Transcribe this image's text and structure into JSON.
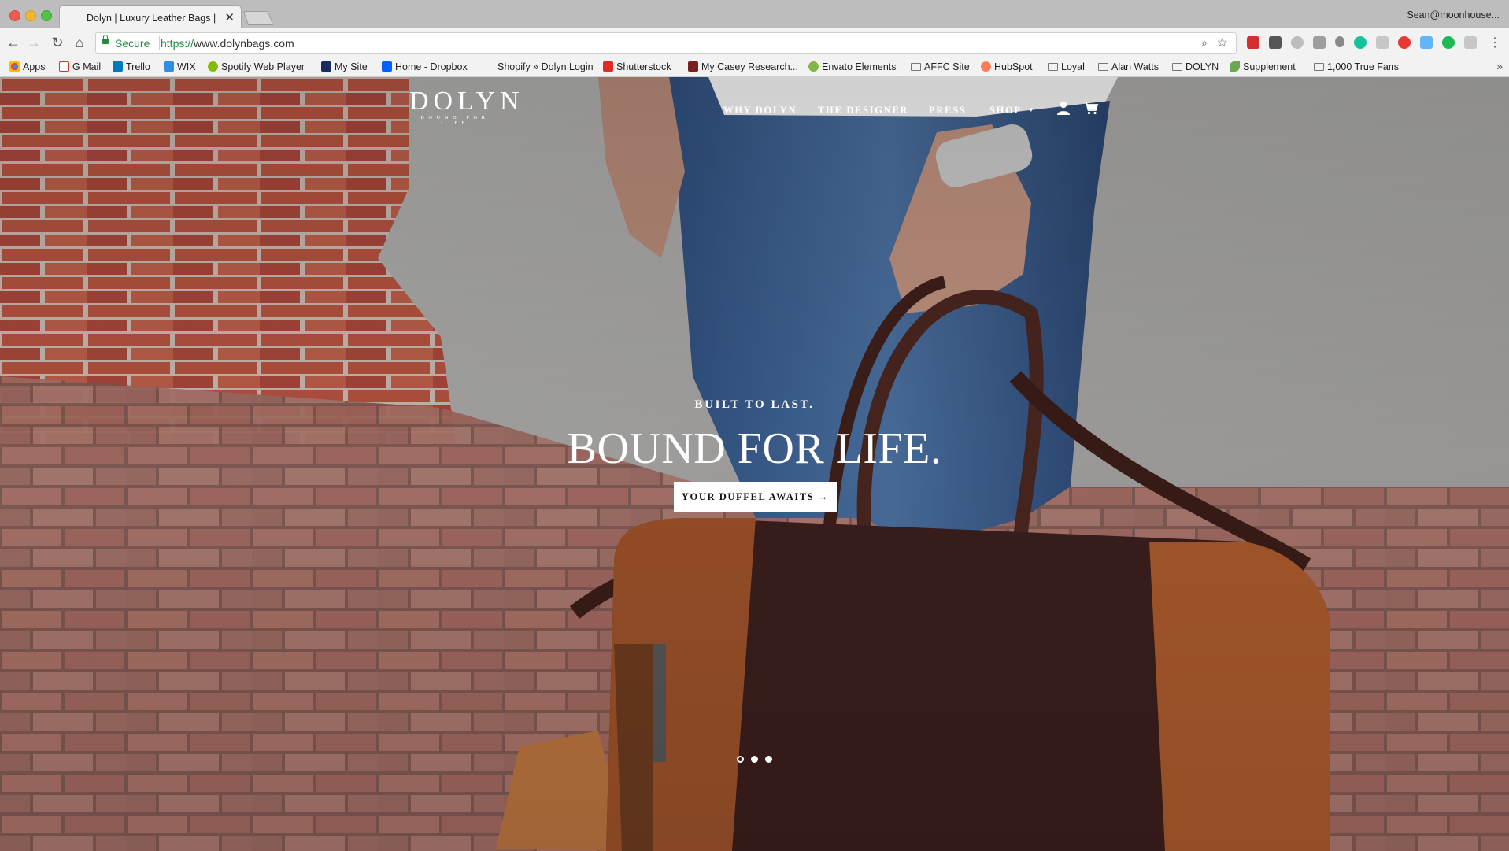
{
  "browser": {
    "tab_title": "Dolyn | Luxury Leather Bags |",
    "profile": "Sean@moonhouse...",
    "secure_label": "Secure",
    "url_scheme": "https://",
    "url_host": "www.dolynbags.com"
  },
  "bookmarks": [
    {
      "label": "Apps",
      "icon": "apps-grid-icon",
      "color": "#4285f4"
    },
    {
      "label": "G Mail",
      "icon": "gmail-icon",
      "color": "#d93025"
    },
    {
      "label": "Trello",
      "icon": "trello-icon",
      "color": "#0079bf"
    },
    {
      "label": "WIX",
      "icon": "wix-icon",
      "color": "#2f8de4"
    },
    {
      "label": "Spotify Web Player",
      "icon": "spotify-icon",
      "color": "#84bd00"
    },
    {
      "label": "My Site",
      "icon": "site-icon",
      "color": "#1a2b5e"
    },
    {
      "label": "Home - Dropbox",
      "icon": "dropbox-icon",
      "color": "#0061fe"
    },
    {
      "label": "Shopify » Dolyn Login",
      "icon": "",
      "color": ""
    },
    {
      "label": "Shutterstock",
      "icon": "shutterstock-icon",
      "color": "#e22a24"
    },
    {
      "label": "My Casey Research...",
      "icon": "casey-icon",
      "color": "#7a1f1f"
    },
    {
      "label": "Envato Elements",
      "icon": "envato-icon",
      "color": "#82b541"
    },
    {
      "label": "AFFC Site",
      "icon": "folder-icon",
      "color": ""
    },
    {
      "label": "HubSpot",
      "icon": "hubspot-icon",
      "color": "#ff7a59"
    },
    {
      "label": "Loyal",
      "icon": "folder-icon",
      "color": ""
    },
    {
      "label": "Alan Watts",
      "icon": "folder-icon",
      "color": ""
    },
    {
      "label": "DOLYN",
      "icon": "folder-icon",
      "color": ""
    },
    {
      "label": "Supplement",
      "icon": "supplement-icon",
      "color": "#6aa84f"
    },
    {
      "label": "1,000 True Fans",
      "icon": "folder-icon",
      "color": ""
    }
  ],
  "site": {
    "brand": "DOLYN",
    "tagline": "BOUND FOR LIFE",
    "nav": [
      "WHY DOLYN",
      "THE DESIGNER",
      "PRESS",
      "SHOP"
    ],
    "hero": {
      "eyebrow": "BUILT TO LAST.",
      "headline": "BOUND FOR LIFE.",
      "cta": "YOUR DUFFEL AWAITS →"
    },
    "slides": {
      "count": 3,
      "active": 1
    }
  }
}
